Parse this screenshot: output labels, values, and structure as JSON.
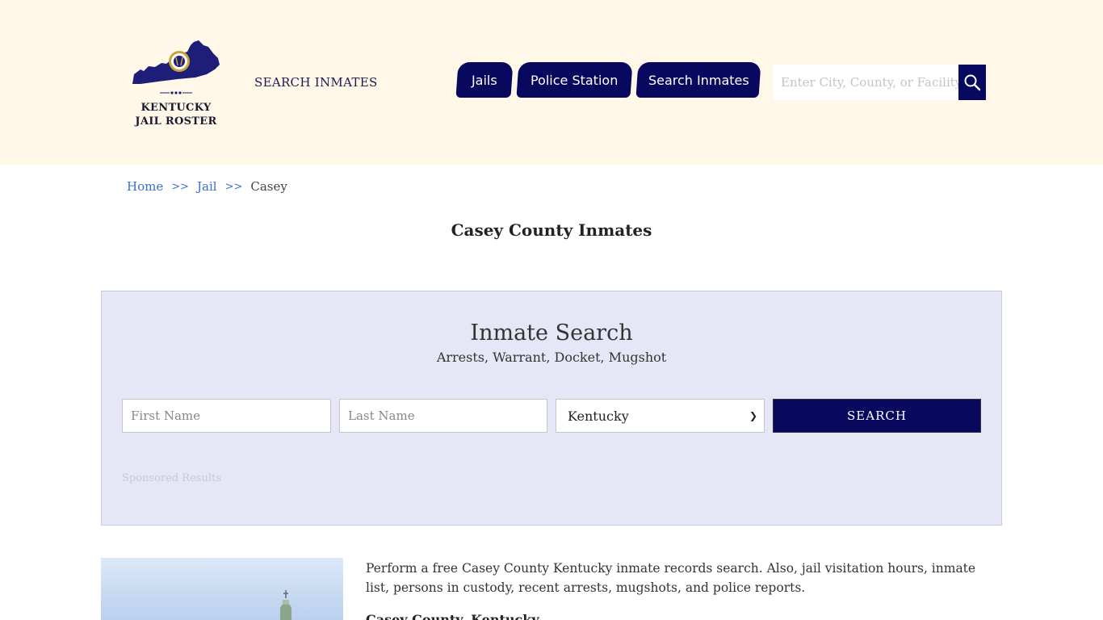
{
  "header": {
    "logo": {
      "line1": "KENTUCKY",
      "line2": "JAIL ROSTER"
    },
    "search_link": "SEARCH INMATES",
    "nav": [
      {
        "label": "Jails"
      },
      {
        "label": "Police Station"
      },
      {
        "label": "Search Inmates"
      }
    ],
    "search": {
      "placeholder": "Enter City, County, or Facility"
    },
    "colors": {
      "background": "#fff8e9",
      "nav": "#08085e"
    }
  },
  "breadcrumb": {
    "home": "Home",
    "separator": ">>",
    "jail": "Jail",
    "current": "Casey"
  },
  "page": {
    "title": "Casey County Inmates"
  },
  "inmate_search": {
    "title": "Inmate Search",
    "subtitle": "Arrests, Warrant, Docket, Mugshot",
    "first_name_placeholder": "First Name",
    "last_name_placeholder": "Last Name",
    "state_selected": "Kentucky",
    "button_label": "SEARCH",
    "sponsored": "Sponsored Results",
    "colors": {
      "panel": "#e5e7f6",
      "button": "#08085e"
    }
  },
  "content": {
    "intro": "Perform a free Casey County Kentucky inmate records search. Also, jail visitation hours, inmate list, persons in custody, recent arrests, mugshots, and police reports.",
    "sub_heading": "Casey County, Kentucky"
  },
  "icons": {
    "logo": "kentucky-state-seal-icon",
    "search": "search-icon",
    "dropdown": "chevron-down-icon"
  }
}
